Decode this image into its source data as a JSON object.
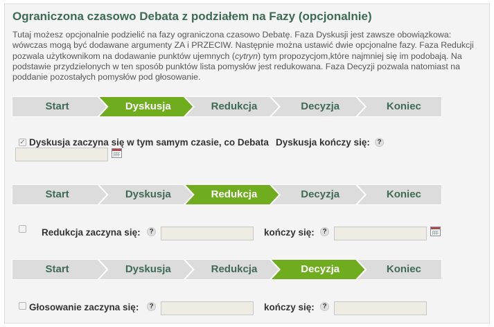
{
  "title": "Ograniczona czasowo Debata z podziałem na Fazy   (opcjonalnie)",
  "description": {
    "text_before_italic": "Tutaj możesz opcjonalnie podzielić na fazy ograniczona czasowo Debatę. Faza Dyskusji jest zawsze obowiązkowa: wówczas mogą być dodawane argumenty ZA i PRZECIW. Następnie można ustawić dwie opcjonalne fazy. Faza Redukcji pozwala użytkownikom na dodawanie punktów ujemnych (",
    "italic": "cytryn",
    "text_after_italic": ") tym propozycjom,które najmniej się im podobają. Na podstawie przydzielonych w ten sposób punktów lista pomysłów jest redukowana. Faza Decyzji pozwala natomiast na poddanie pozostałych pomysłów pod głosowanie."
  },
  "phases": [
    "Start",
    "Dyskusja",
    "Redukcja",
    "Decyzja",
    "Koniec"
  ],
  "colors": {
    "active_step": "#6fad1e",
    "inactive_step": "#dcdcdc",
    "title": "#3d6b56",
    "panel_bg": "#f4f4f4",
    "input_bg": "#efede3"
  },
  "discussion": {
    "active_phase": "Dyskusja",
    "checkbox_checked": true,
    "checkbox_label": "Dyskusja zaczyna się w tym samym czasie, co Debata",
    "end_label": "Dyskusja kończy się:",
    "help_icon": "?",
    "end_value": ""
  },
  "reduction": {
    "active_phase": "Redukcja",
    "checkbox_checked": false,
    "start_label": "Redukcja zaczyna się:",
    "start_value": "",
    "end_label": "kończy się:",
    "end_value": "",
    "help_icon": "?"
  },
  "decision": {
    "active_phase": "Decyzja",
    "checkbox_checked": false,
    "start_label": "Głosowanie zaczyna się:",
    "start_value": "",
    "end_label": "kończy się:",
    "end_value": "",
    "help_icon": "?"
  }
}
